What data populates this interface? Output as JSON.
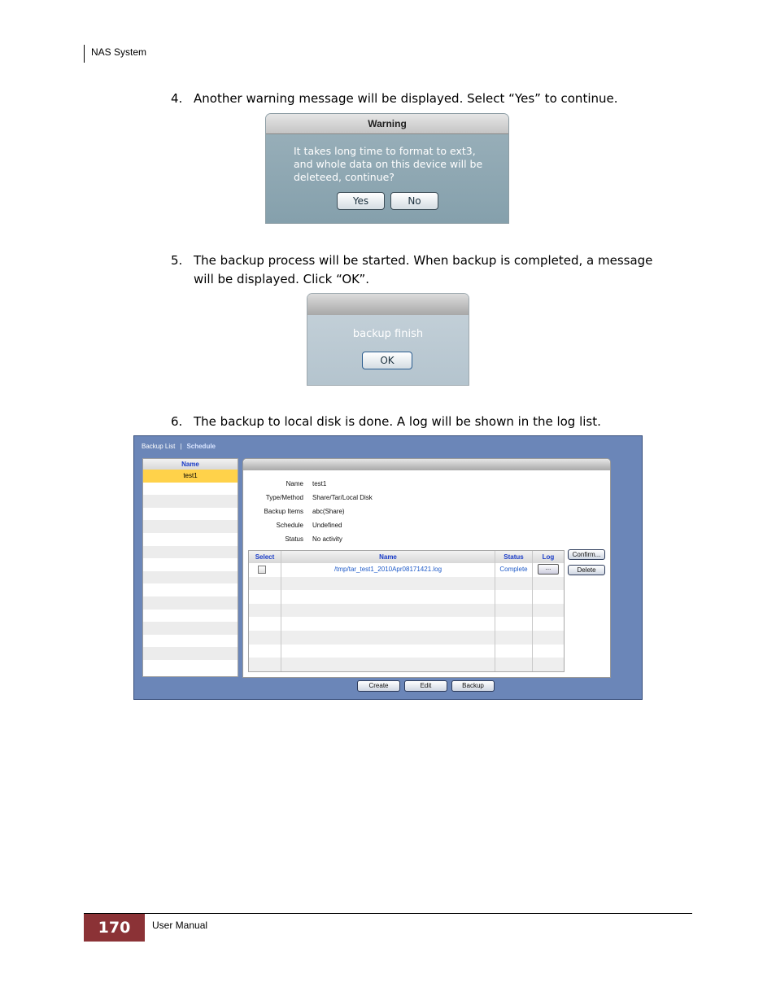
{
  "header": {
    "title": "NAS System"
  },
  "footer": {
    "page_number": "170",
    "label": "User Manual"
  },
  "steps": [
    {
      "num": "4.",
      "line1": "Another warning message will be displayed. Select “Yes” to continue."
    },
    {
      "num": "5.",
      "line1": "The backup process will be started. When backup is completed, a message",
      "line2": "will be displayed. Click “OK”."
    },
    {
      "num": "6.",
      "line1": "The backup to local disk is done. A log will be shown in the log list."
    }
  ],
  "warning_dialog": {
    "title": "Warning",
    "message_lines": [
      "It takes long time to format to ext3,",
      "and whole data on this device will be",
      "deleteed, continue?"
    ],
    "yes_label": "Yes",
    "no_label": "No"
  },
  "finish_dialog": {
    "message": "backup finish",
    "ok_label": "OK"
  },
  "backup_panel": {
    "tabs": [
      "Backup List",
      "Schedule"
    ],
    "list": {
      "header": "Name",
      "items": [
        "test1"
      ]
    },
    "details": [
      {
        "key": "Name",
        "value": "test1"
      },
      {
        "key": "Type/Method",
        "value": "Share/Tar/Local Disk"
      },
      {
        "key": "Backup Items",
        "value": "abc(Share)"
      },
      {
        "key": "Schedule",
        "value": "Undefined"
      },
      {
        "key": "Status",
        "value": "No activity"
      }
    ],
    "log_table": {
      "headers": [
        "Select",
        "Name",
        "Status",
        "Log"
      ],
      "rows": [
        {
          "name": "/tmp/tar_test1_2010Apr08171421.log",
          "status": "Complete",
          "log": "..."
        }
      ]
    },
    "side_buttons": {
      "confirm": "Confirm...",
      "delete": "Delete"
    },
    "bottom_buttons": {
      "create": "Create",
      "edit": "Edit",
      "backup": "Backup"
    }
  }
}
